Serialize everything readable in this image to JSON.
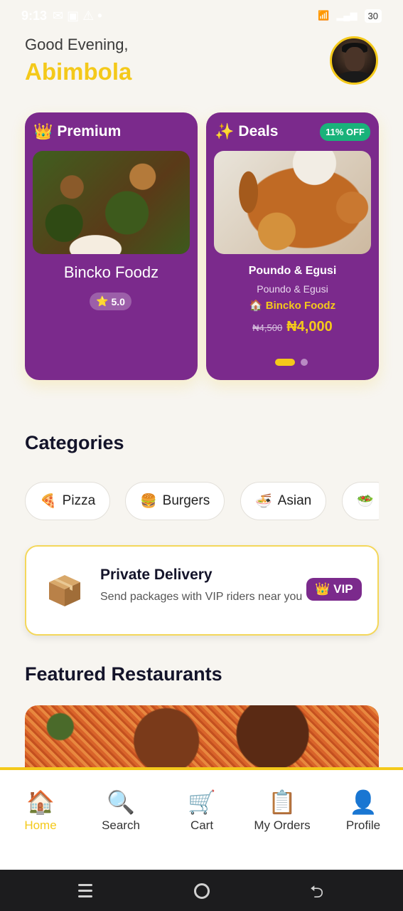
{
  "status_bar": {
    "time": "9:13",
    "battery": "30"
  },
  "header": {
    "greeting": "Good Evening,",
    "user_name": "Abimbola"
  },
  "premium_card": {
    "title": "Premium",
    "icon": "crown-icon",
    "restaurant": "Bincko Foodz",
    "rating": "5.0"
  },
  "deals_card": {
    "title": "Deals",
    "icon": "sparkles-icon",
    "discount": "11% OFF",
    "item_name": "Poundo  & Egusi",
    "item_desc": "Poundo  & Egusi",
    "vendor": "Bincko Foodz",
    "old_price": "₦4,500",
    "new_price": "₦4,000",
    "carousel_active_index": 0,
    "carousel_count": 2
  },
  "categories": {
    "title": "Categories",
    "items": [
      {
        "emoji": "🍕",
        "label": "Pizza"
      },
      {
        "emoji": "🍔",
        "label": "Burgers"
      },
      {
        "emoji": "🍜",
        "label": "Asian"
      },
      {
        "emoji": "🥗",
        "label": ""
      }
    ]
  },
  "delivery": {
    "title": "Private Delivery",
    "description": "Send packages with VIP riders near you",
    "badge": "VIP",
    "icon": "package-icon"
  },
  "featured": {
    "title": "Featured Restaurants"
  },
  "bottom_nav": {
    "items": [
      {
        "icon": "🏠",
        "label": "Home",
        "active": true
      },
      {
        "icon": "🔍",
        "label": "Search",
        "active": false
      },
      {
        "icon": "🛒",
        "label": "Cart",
        "active": false
      },
      {
        "icon": "📋",
        "label": "My Orders",
        "active": false
      },
      {
        "icon": "👤",
        "label": "Profile",
        "active": false
      }
    ]
  },
  "colors": {
    "accent_yellow": "#f4c91a",
    "card_purple": "#7b2a8c",
    "discount_green": "#19b27a",
    "background": "#f7f5f0"
  }
}
